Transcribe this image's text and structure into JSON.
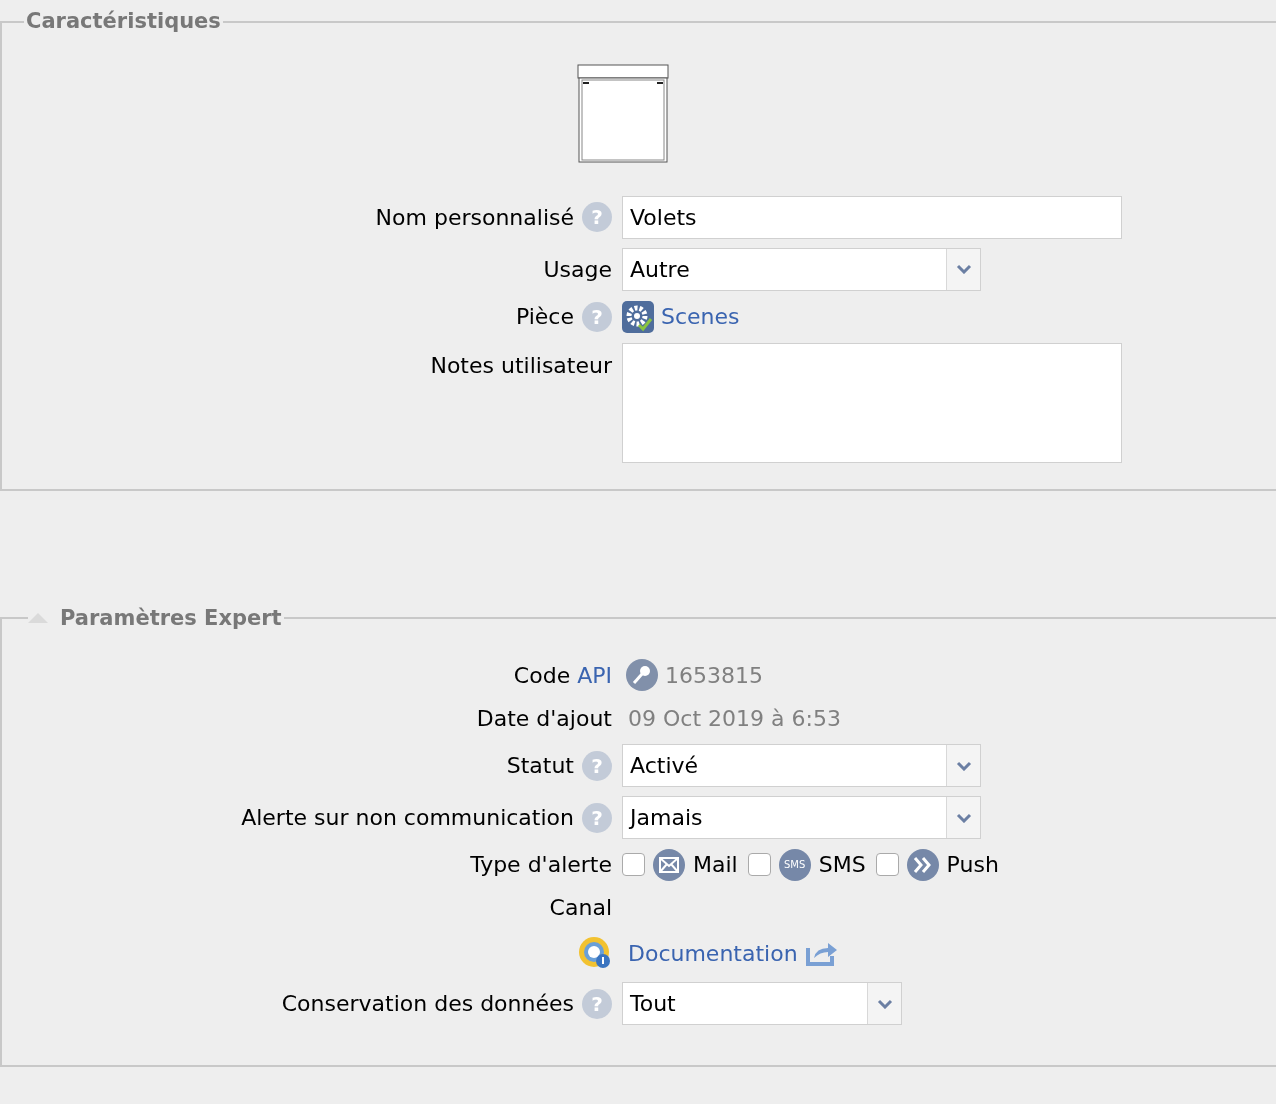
{
  "sections": [
    {
      "title": "Caractéristiques",
      "fields": [
        {
          "kind": "text",
          "label": "Nom personnalisé",
          "help": "?",
          "value": "Volets"
        },
        {
          "kind": "select",
          "label": "Usage",
          "value": "Autre"
        },
        {
          "kind": "link",
          "label": "Pièce",
          "help": "?",
          "value": "Scenes"
        },
        {
          "kind": "textarea",
          "label": "Notes utilisateur"
        }
      ]
    },
    {
      "title": "Paramètres Expert",
      "expanded": true,
      "fields": [
        {
          "kind": "api",
          "label": "Code",
          "link": "API",
          "value": "1653815"
        },
        {
          "kind": "plain",
          "label": "Date d'ajout",
          "value": "09 Oct 2019 à 6:53"
        },
        {
          "kind": "select",
          "label": "Statut",
          "help": "?",
          "value": "Activé"
        },
        {
          "kind": "select",
          "label": "Alerte sur non communication",
          "help": "?",
          "value": "Jamais"
        },
        {
          "kind": "checkboxes",
          "label": "Type d'alerte",
          "options": [
            {
              "kind": "mail",
              "label": "Mail",
              "checked": false
            },
            {
              "kind": "sms",
              "label": "SMS",
              "icon_text": "SMS",
              "checked": false
            },
            {
              "kind": "push",
              "label": "Push",
              "checked": false
            }
          ]
        },
        {
          "kind": "label_only",
          "label": "Canal"
        },
        {
          "kind": "doc",
          "link": "Documentation"
        },
        {
          "kind": "select_short",
          "label": "Conservation des données",
          "help": "?",
          "value": "Tout"
        }
      ]
    }
  ]
}
